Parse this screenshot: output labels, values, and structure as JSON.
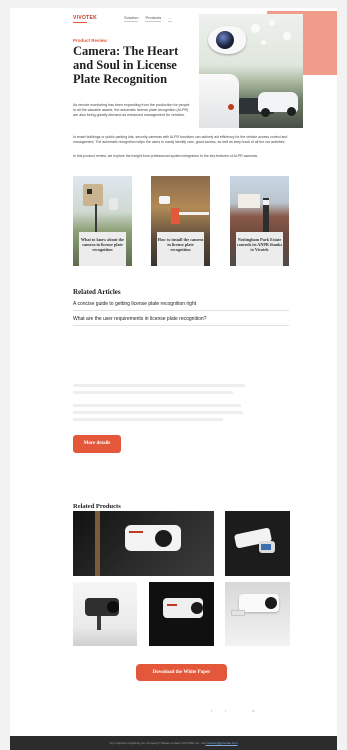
{
  "header": {
    "logo": "VIVOTEK",
    "nav": [
      "Solution",
      "Products",
      "..."
    ]
  },
  "hero": {
    "label": "Product Review",
    "title": "Camera: The Heart and Soul in License Plate Recognition",
    "intro": "As remote monitoring has been expanding from the production for people to all the valuable assets, the automatic license plate recognition (ALPR) are also being greatly demand as enhanced management for vehicles."
  },
  "body": {
    "paragraph_1": "In smart buildings or public parking lots, security cameras with ALPR functions can actively aid efficiency for the vehicle access control and management. The automatic recognition helps the users to easily identify cars, grant access, as well as keep track of all the car activities.",
    "paragraph_2": "In this product review, we explore the insight from professional system integrators to the key features of ALPR cameras."
  },
  "articles": [
    {
      "caption": "What to know about the camera in license plate recognition"
    },
    {
      "caption": "How to install the camera in license plate recognition"
    },
    {
      "caption": "Nottingham Park Estate controls its ANPR thanks to Vivotek"
    }
  ],
  "related_articles": {
    "heading": "Related Articles",
    "links": [
      "A concise guide to getting license plate recognition right",
      "What are the user requirements in license plate recognition?"
    ]
  },
  "more_button": "More details",
  "related_products": {
    "heading": "Related Products"
  },
  "download_button": "Download the White Paper",
  "social": [
    "f",
    "t",
    "in"
  ],
  "footer": {
    "text": "Any inquiries regarding our company? Please contact VIVOTEK Inc. via",
    "link": "marketing@vivotek.com"
  },
  "colors": {
    "accent": "#e3573a",
    "salmon": "#ef9d8a",
    "footer_bg": "#2c2c2c"
  }
}
